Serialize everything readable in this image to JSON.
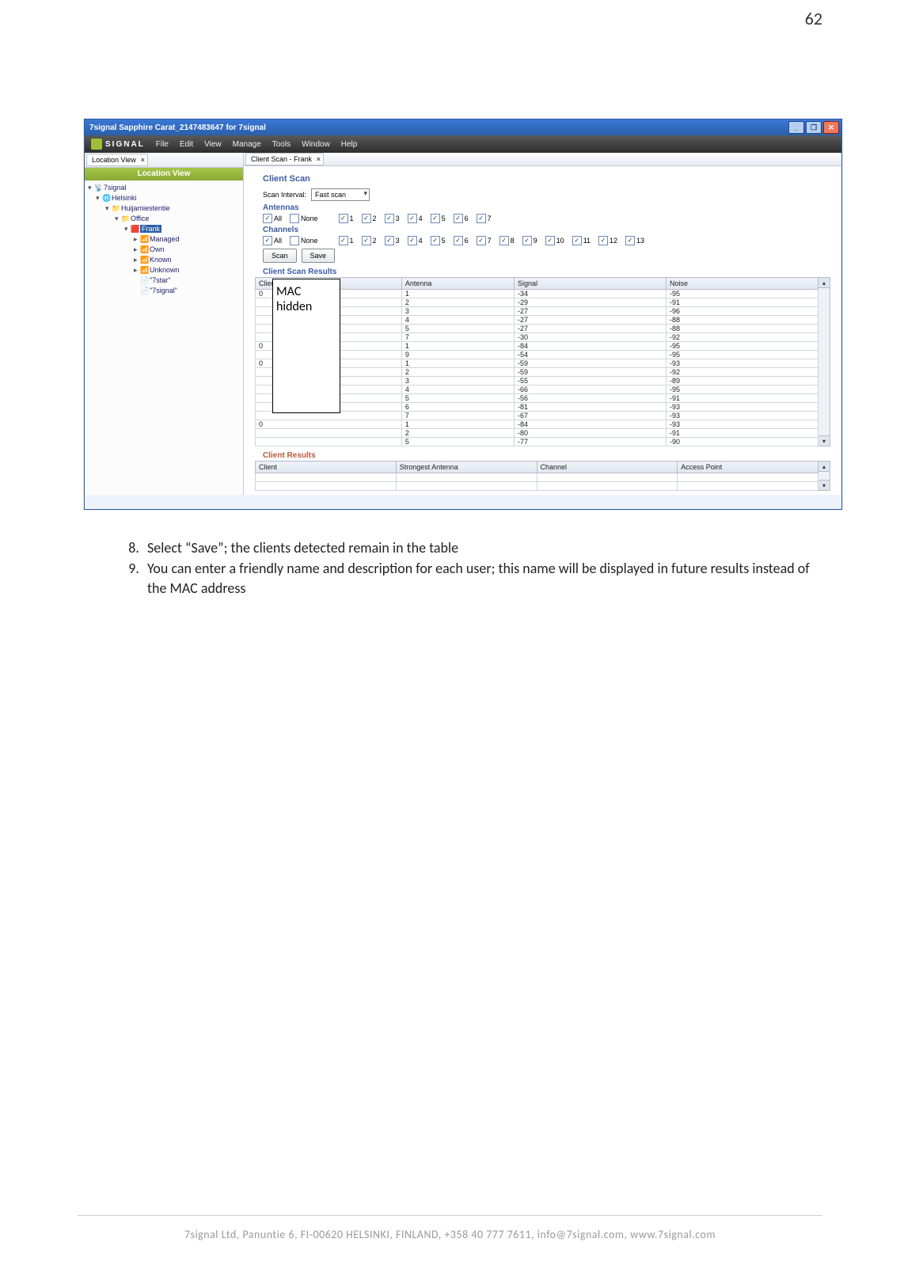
{
  "page": {
    "number": "62"
  },
  "titlebar": {
    "text": "7signal Sapphire Carat_2147483647 for 7signal"
  },
  "brand": {
    "name": "SIGNAL"
  },
  "menus": [
    "File",
    "Edit",
    "View",
    "Manage",
    "Tools",
    "Window",
    "Help"
  ],
  "leftTab": {
    "label": "Location View"
  },
  "rightTab": {
    "label": "Client Scan - Frank"
  },
  "sidebar": {
    "title": "Location View",
    "nodes": [
      {
        "indent": 0,
        "twisty": "▾",
        "icon": "📡",
        "label": "7signal"
      },
      {
        "indent": 1,
        "twisty": "▾",
        "icon": "🌐",
        "label": "Helsinki"
      },
      {
        "indent": 2,
        "twisty": "▾",
        "icon": "📁",
        "label": "Huijamiestentie"
      },
      {
        "indent": 3,
        "twisty": "▾",
        "icon": "📁",
        "label": "Office"
      },
      {
        "indent": 4,
        "twisty": "▾",
        "icon": "🟥",
        "label": "Frank",
        "selected": true
      },
      {
        "indent": 5,
        "twisty": "▸",
        "icon": "📶",
        "label": "Managed"
      },
      {
        "indent": 5,
        "twisty": "▸",
        "icon": "📶",
        "label": "Own"
      },
      {
        "indent": 5,
        "twisty": "▸",
        "icon": "📶",
        "label": "Known"
      },
      {
        "indent": 5,
        "twisty": "▸",
        "icon": "📶",
        "label": "Unknown"
      },
      {
        "indent": 5,
        "twisty": "",
        "icon": "📄",
        "label": "\"7star\""
      },
      {
        "indent": 5,
        "twisty": "",
        "icon": "📄",
        "label": "\"7signal\""
      }
    ]
  },
  "scan": {
    "title": "Client Scan",
    "scanIntervalLabel": "Scan Interval:",
    "scanIntervalValue": "Fast scan",
    "antennasLabel": "Antennas",
    "channelsLabel": "Channels",
    "allLabel": "All",
    "noneLabel": "None",
    "antennaNums": [
      "1",
      "2",
      "3",
      "4",
      "5",
      "6",
      "7"
    ],
    "channelNums": [
      "1",
      "2",
      "3",
      "4",
      "5",
      "6",
      "7",
      "8",
      "9",
      "10",
      "11",
      "12",
      "13"
    ],
    "scanBtn": "Scan",
    "saveBtn": "Save"
  },
  "resultsA": {
    "title": "Client Scan Results",
    "headers": [
      "Client MAC",
      "Antenna",
      "Signal",
      "Noise"
    ],
    "rows": [
      [
        "0",
        "1",
        "-34",
        "-95"
      ],
      [
        "",
        "2",
        "-29",
        "-91"
      ],
      [
        "",
        "3",
        "-27",
        "-96"
      ],
      [
        "",
        "4",
        "-27",
        "-88"
      ],
      [
        "",
        "5",
        "-27",
        "-88"
      ],
      [
        "",
        "7",
        "-30",
        "-92"
      ],
      [
        "0",
        "1",
        "-84",
        "-95"
      ],
      [
        "",
        "9",
        "-54",
        "-95"
      ],
      [
        "0",
        "1",
        "-59",
        "-93"
      ],
      [
        "",
        "2",
        "-59",
        "-92"
      ],
      [
        "",
        "3",
        "-55",
        "-89"
      ],
      [
        "",
        "4",
        "-66",
        "-95"
      ],
      [
        "",
        "5",
        "-56",
        "-91"
      ],
      [
        "",
        "6",
        "-81",
        "-93"
      ],
      [
        "",
        "7",
        "-67",
        "-93"
      ],
      [
        "0",
        "1",
        "-84",
        "-93"
      ],
      [
        "",
        "2",
        "-80",
        "-91"
      ],
      [
        "",
        "5",
        "-77",
        "-90"
      ]
    ]
  },
  "resultsB": {
    "title": "Client Results",
    "headers": [
      "Client",
      "Strongest Antenna",
      "Channel",
      "Access Point"
    ]
  },
  "overlay": {
    "line1": "MAC",
    "line2": "hidden"
  },
  "instructions": {
    "items": [
      "Select “Save”; the clients detected remain in the table",
      "You can enter a friendly name and description for each user; this name will be displayed in future results instead of the MAC address"
    ]
  },
  "footer": "7signal Ltd, Panuntie 6, FI-00620 HELSINKI, FINLAND, +358 40 777 7611, info@7signal.com, www.7signal.com"
}
